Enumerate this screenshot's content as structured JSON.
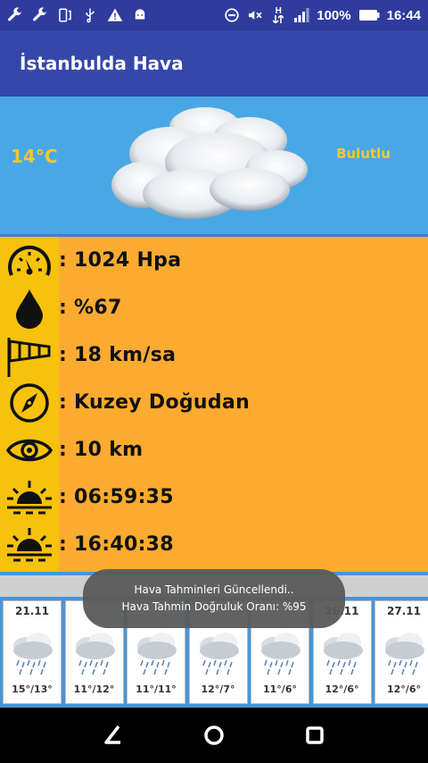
{
  "status_bar": {
    "battery_percent": "100%",
    "time": "16:44",
    "left_icons": [
      "wrench-icon",
      "wrench-icon",
      "phone-rotate-icon",
      "usb-icon",
      "warning-icon",
      "android-icon"
    ],
    "right_icons": [
      "dnd-icon",
      "mute-icon",
      "data-h-icon",
      "signal-icon",
      "battery-icon"
    ],
    "data_label": "H"
  },
  "app_bar": {
    "title": "İstanbulda Hava"
  },
  "current": {
    "temperature": "14°C",
    "condition": "Bulutlu"
  },
  "details": [
    {
      "icon": "pressure-gauge-icon",
      "value": ": 1024 Hpa"
    },
    {
      "icon": "humidity-drop-icon",
      "value": ": %67"
    },
    {
      "icon": "windsock-icon",
      "value": ": 18 km/sa"
    },
    {
      "icon": "compass-icon",
      "value": ": Kuzey Doğudan"
    },
    {
      "icon": "visibility-eye-icon",
      "value": ": 10 km"
    },
    {
      "icon": "sunrise-icon",
      "value": ": 06:59:35"
    },
    {
      "icon": "sunset-icon",
      "value": ": 16:40:38"
    }
  ],
  "forecast": [
    {
      "date": "21.11",
      "range": "15°/13°",
      "icon": "rain-cloud-icon"
    },
    {
      "date": "",
      "range": "11°/12°",
      "icon": "rain-cloud-icon"
    },
    {
      "date": "",
      "range": "11°/11°",
      "icon": "rain-cloud-icon"
    },
    {
      "date": "",
      "range": "12°/7°",
      "icon": "rain-cloud-icon"
    },
    {
      "date": "",
      "range": "11°/6°",
      "icon": "rain-cloud-icon"
    },
    {
      "date": "26.11",
      "range": "12°/6°",
      "icon": "rain-cloud-icon"
    },
    {
      "date": "27.11",
      "range": "12°/6°",
      "icon": "rain-cloud-icon"
    }
  ],
  "toast": {
    "line1": "Hava Tahminleri Güncellendi..",
    "line2": "Hava Tahmin Doğruluk Oranı: %95"
  },
  "nav": [
    "back-icon",
    "home-icon",
    "recents-icon"
  ],
  "colors": {
    "status_bar": "#2f3c9e",
    "app_bar": "#3647aa",
    "sky": "#48a8e6",
    "details_bg": "#fbab30",
    "icon_column": "#f6c20b",
    "accent_text": "#f8c630"
  }
}
